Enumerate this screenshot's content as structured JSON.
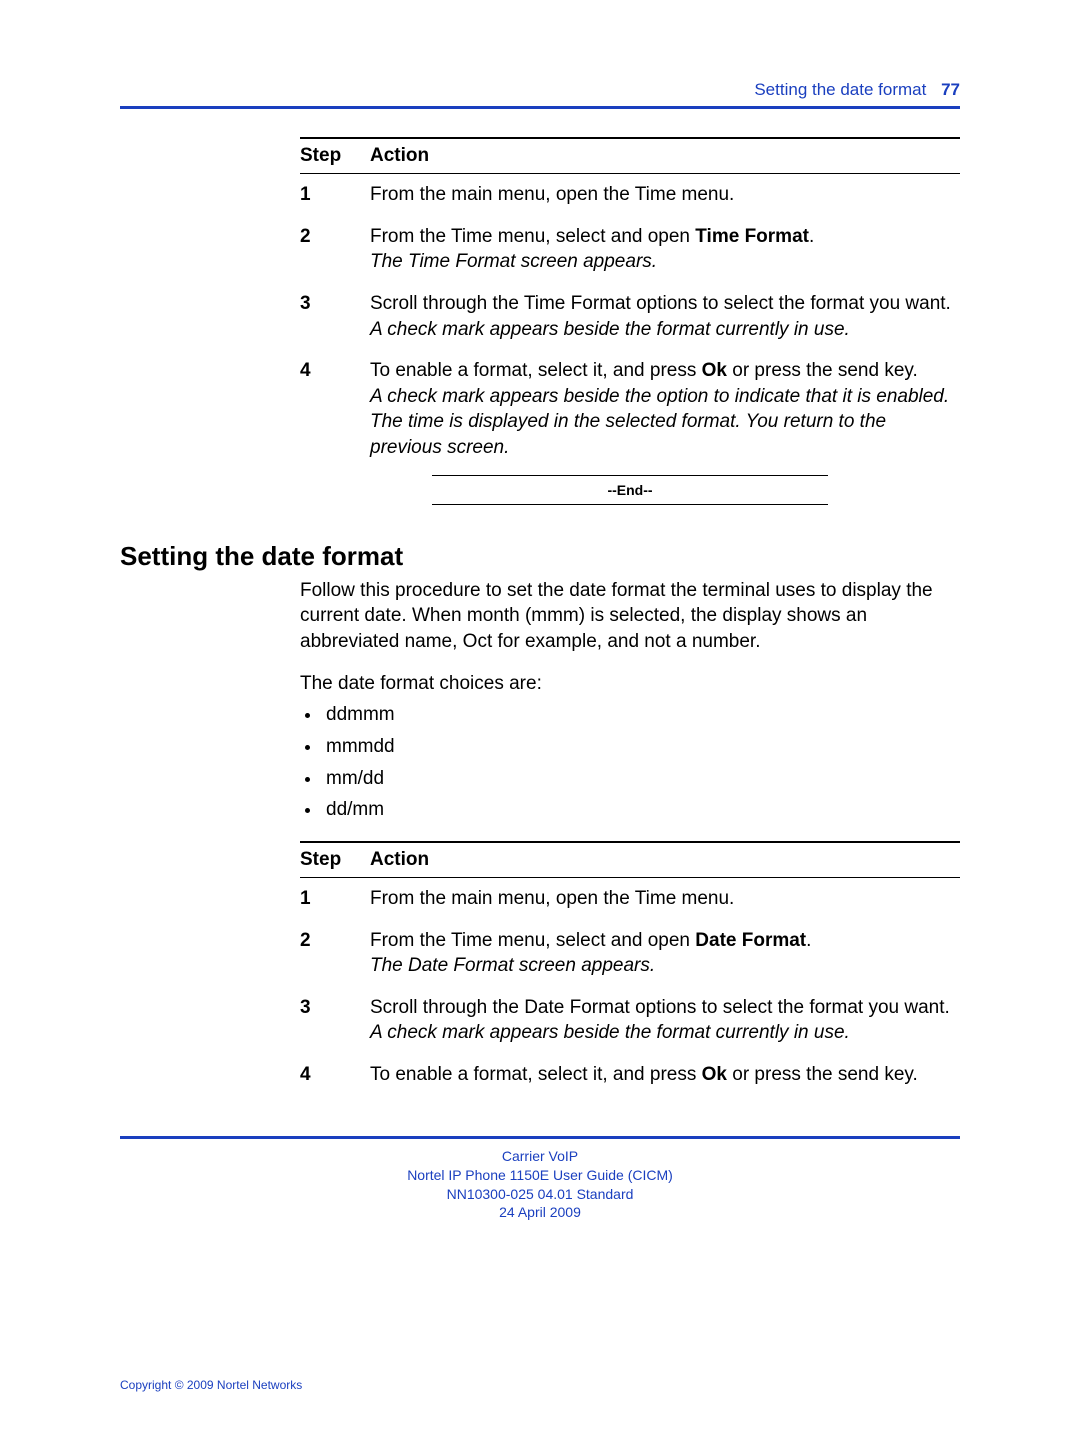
{
  "header": {
    "section": "Setting the date format",
    "page_number": "77"
  },
  "table1": {
    "head_step": "Step",
    "head_action": "Action",
    "rows": [
      {
        "n": "1",
        "text": "From the main menu, open the Time menu."
      },
      {
        "n": "2",
        "text_a": "From the Time menu, select and open ",
        "bold": "Time Format",
        "text_b": ".",
        "italic": "The Time Format screen appears."
      },
      {
        "n": "3",
        "text": "Scroll through the Time Format options to select the format you want.",
        "italic": "A check mark appears beside the format currently in use."
      },
      {
        "n": "4",
        "text_a": "To enable a format, select it, and press ",
        "bold": "Ok",
        "text_b": " or press the send key.",
        "italic": "A check mark appears beside the option to indicate that it is enabled.  The time is displayed in the selected format. You return to the previous screen."
      }
    ],
    "end": "--End--"
  },
  "section": {
    "heading": "Setting the date format",
    "p1": "Follow this procedure to set the date format the terminal uses to display the current date. When month (mmm) is selected, the display shows an abbreviated name, Oct for example, and not a number.",
    "p2": "The date format choices are:",
    "choices": [
      "ddmmm",
      "mmmdd",
      "mm/dd",
      "dd/mm"
    ]
  },
  "table2": {
    "head_step": "Step",
    "head_action": "Action",
    "rows": [
      {
        "n": "1",
        "text": "From the main menu, open the Time menu."
      },
      {
        "n": "2",
        "text_a": "From the Time menu, select and open ",
        "bold": "Date Format",
        "text_b": ".",
        "italic": "The Date Format screen appears."
      },
      {
        "n": "3",
        "text": "Scroll through the Date Format options to select the format you want.",
        "italic": "A check mark appears beside the format currently in use."
      },
      {
        "n": "4",
        "text_a": "To enable a format, select it, and press ",
        "bold": "Ok",
        "text_b": " or press the send key."
      }
    ]
  },
  "footer": {
    "l1": "Carrier VoIP",
    "l2": "Nortel IP Phone 1150E User Guide (CICM)",
    "l3": "NN10300-025   04.01   Standard",
    "l4": "24 April 2009",
    "copyright": "Copyright © 2009 Nortel Networks"
  }
}
